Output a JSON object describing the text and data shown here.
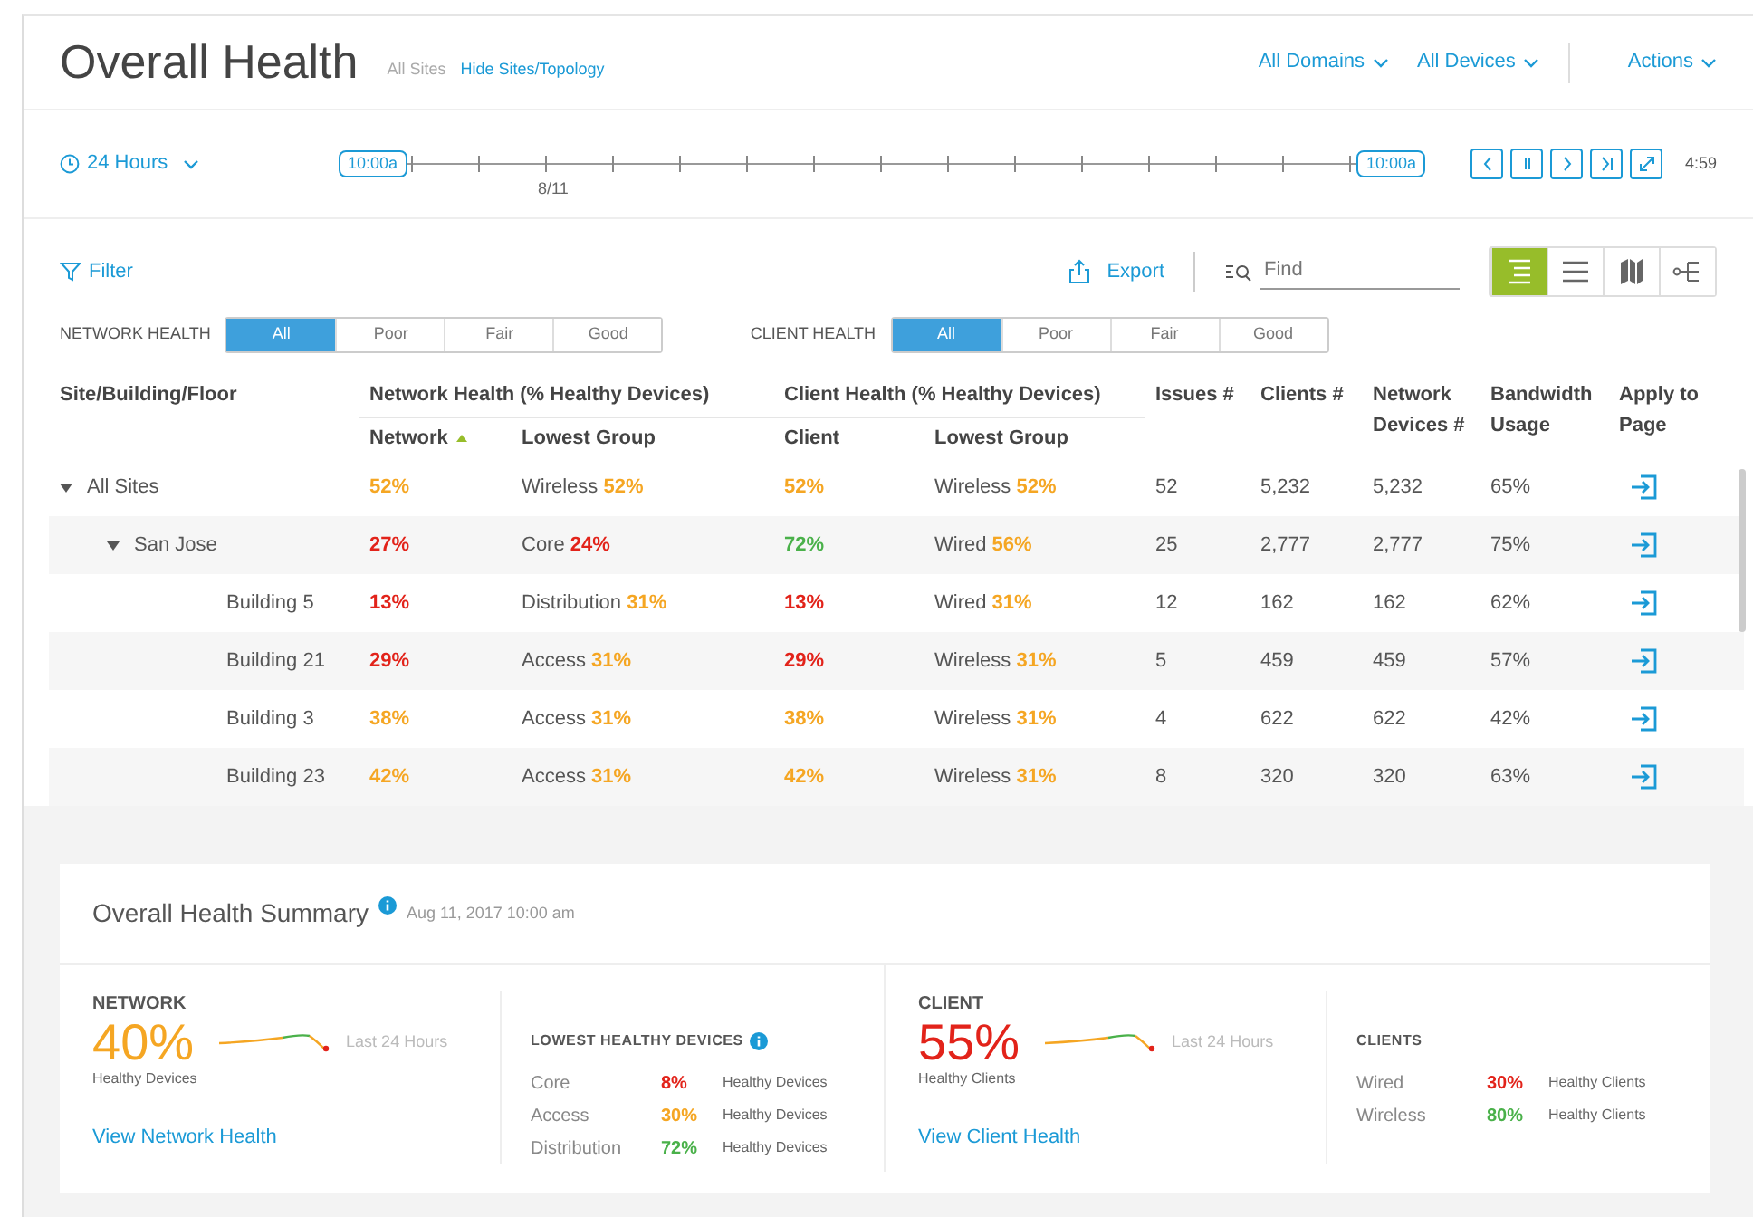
{
  "header": {
    "title": "Overall Health",
    "scope": "All Sites",
    "toggle_link": "Hide Sites/Topology",
    "menus": [
      {
        "label": "All Domains"
      },
      {
        "label": "All Devices"
      },
      {
        "label": "Actions"
      }
    ]
  },
  "timeline": {
    "range": "24 Hours",
    "start_handle": "10:00a",
    "end_handle": "10:00a",
    "date_label": "8/11",
    "controls": [
      {
        "kind": "prev"
      },
      {
        "kind": "pause"
      },
      {
        "kind": "next"
      },
      {
        "kind": "end"
      },
      {
        "kind": "expand"
      }
    ],
    "countdown": "4:59"
  },
  "toolbar": {
    "filter": "Filter",
    "export": "Export",
    "find_placeholder": "Find",
    "view_modes": [
      {
        "kind": "tree",
        "selected": true
      },
      {
        "kind": "list",
        "selected": false
      },
      {
        "kind": "map",
        "selected": false
      },
      {
        "kind": "topology",
        "selected": false
      }
    ]
  },
  "filters": [
    {
      "label": "NETWORK HEALTH",
      "options": [
        {
          "label": "All",
          "selected": true
        },
        {
          "label": "Poor",
          "selected": false
        },
        {
          "label": "Fair",
          "selected": false
        },
        {
          "label": "Good",
          "selected": false
        }
      ]
    },
    {
      "label": "CLIENT HEALTH",
      "options": [
        {
          "label": "All",
          "selected": true
        },
        {
          "label": "Poor",
          "selected": false
        },
        {
          "label": "Fair",
          "selected": false
        },
        {
          "label": "Good",
          "selected": false
        }
      ]
    }
  ],
  "table": {
    "columns": {
      "site": "Site/Building/Floor",
      "network_group": "Network Health (% Healthy Devices)",
      "client_group": "Client Health (% Healthy Devices)",
      "network": "Network",
      "network_lowest": "Lowest Group",
      "client": "Client",
      "client_lowest": "Lowest Group",
      "issues": "Issues #",
      "clients": "Clients #",
      "devices": "Network Devices #",
      "bandwidth": "Bandwidth Usage",
      "apply": "Apply to Page"
    },
    "rows": [
      {
        "name": "All Sites",
        "expanded": true,
        "network": {
          "value": "52%",
          "color": "#f5a623"
        },
        "network_lowest": {
          "group": "Wireless",
          "value": "52%",
          "color": "#f5a623"
        },
        "client": {
          "value": "52%",
          "color": "#f5a623"
        },
        "client_lowest": {
          "group": "Wireless",
          "value": "52%",
          "color": "#f5a623"
        },
        "issues": "52",
        "clients": "5,232",
        "devices": "5,232",
        "bandwidth": "65%",
        "children": [
          {
            "name": "San Jose",
            "expanded": true,
            "network": {
              "value": "27%",
              "color": "#e2231a"
            },
            "network_lowest": {
              "group": "Core",
              "value": "24%",
              "color": "#e2231a"
            },
            "client": {
              "value": "72%",
              "color": "#4ab14a"
            },
            "client_lowest": {
              "group": "Wired",
              "value": "56%",
              "color": "#f5a623"
            },
            "issues": "25",
            "clients": "2,777",
            "devices": "2,777",
            "bandwidth": "75%",
            "children": [
              {
                "name": "Building 5",
                "network": {
                  "value": "13%",
                  "color": "#e2231a"
                },
                "network_lowest": {
                  "group": "Distribution",
                  "value": "31%",
                  "color": "#f5a623"
                },
                "client": {
                  "value": "13%",
                  "color": "#e2231a"
                },
                "client_lowest": {
                  "group": "Wired",
                  "value": "31%",
                  "color": "#f5a623"
                },
                "issues": "12",
                "clients": "162",
                "devices": "162",
                "bandwidth": "62%"
              },
              {
                "name": "Building 21",
                "network": {
                  "value": "29%",
                  "color": "#e2231a"
                },
                "network_lowest": {
                  "group": "Access",
                  "value": "31%",
                  "color": "#f5a623"
                },
                "client": {
                  "value": "29%",
                  "color": "#e2231a"
                },
                "client_lowest": {
                  "group": "Wireless",
                  "value": "31%",
                  "color": "#f5a623"
                },
                "issues": "5",
                "clients": "459",
                "devices": "459",
                "bandwidth": "57%"
              },
              {
                "name": "Building 3",
                "network": {
                  "value": "38%",
                  "color": "#f5a623"
                },
                "network_lowest": {
                  "group": "Access",
                  "value": "31%",
                  "color": "#f5a623"
                },
                "client": {
                  "value": "38%",
                  "color": "#f5a623"
                },
                "client_lowest": {
                  "group": "Wireless",
                  "value": "31%",
                  "color": "#f5a623"
                },
                "issues": "4",
                "clients": "622",
                "devices": "622",
                "bandwidth": "42%"
              },
              {
                "name": "Building 23",
                "network": {
                  "value": "42%",
                  "color": "#f5a623"
                },
                "network_lowest": {
                  "group": "Access",
                  "value": "31%",
                  "color": "#f5a623"
                },
                "client": {
                  "value": "42%",
                  "color": "#f5a623"
                },
                "client_lowest": {
                  "group": "Wireless",
                  "value": "31%",
                  "color": "#f5a623"
                },
                "issues": "8",
                "clients": "320",
                "devices": "320",
                "bandwidth": "63%"
              }
            ]
          }
        ]
      }
    ]
  },
  "summary": {
    "title": "Overall Health Summary",
    "timestamp": "Aug 11, 2017 10:00 am",
    "panels": [
      {
        "heading": "NETWORK",
        "percent": "40%",
        "color": "#f5a623",
        "caption": "Healthy Devices",
        "trend_label": "Last 24 Hours",
        "link": "View Network Health",
        "breakdown_title": "LOWEST HEALTHY DEVICES",
        "breakdown_info": true,
        "breakdown": [
          {
            "name": "Core",
            "value": "8%",
            "color": "#e2231a",
            "caption": "Healthy Devices"
          },
          {
            "name": "Access",
            "value": "30%",
            "color": "#f5a623",
            "caption": "Healthy Devices"
          },
          {
            "name": "Distribution",
            "value": "72%",
            "color": "#4ab14a",
            "caption": "Healthy Devices"
          }
        ]
      },
      {
        "heading": "CLIENT",
        "percent": "55%",
        "color": "#e2231a",
        "caption": "Healthy Clients",
        "trend_label": "Last 24 Hours",
        "link": "View Client Health",
        "breakdown_title": "CLIENTS",
        "breakdown_info": false,
        "breakdown": [
          {
            "name": "Wired",
            "value": "30%",
            "color": "#e2231a",
            "caption": "Healthy Clients"
          },
          {
            "name": "Wireless",
            "value": "80%",
            "color": "#4ab14a",
            "caption": "Healthy Clients"
          }
        ]
      }
    ]
  }
}
